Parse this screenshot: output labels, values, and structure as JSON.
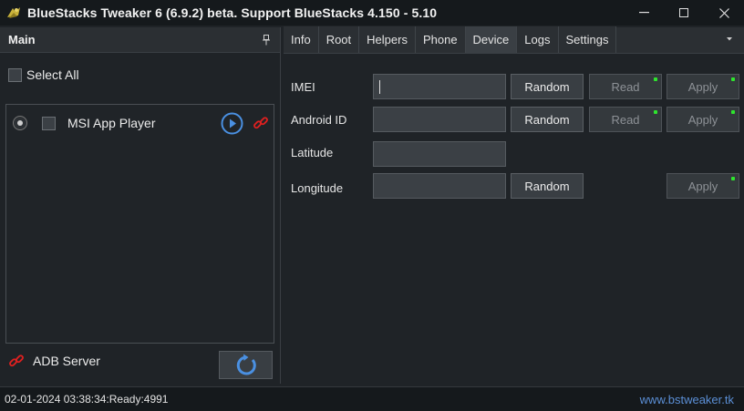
{
  "window": {
    "title": "BlueStacks Tweaker 6 (6.9.2) beta. Support BlueStacks 4.150 - 5.10",
    "minimize_label": "—",
    "maximize_label": "☐",
    "close_label": "✕"
  },
  "left": {
    "header": "Main",
    "select_all": "Select All",
    "players": [
      {
        "name": "MSI App Player",
        "selected": true,
        "checked": false
      }
    ],
    "adb_label": "ADB Server"
  },
  "tabs": [
    {
      "label": "Info",
      "active": false
    },
    {
      "label": "Root",
      "active": false
    },
    {
      "label": "Helpers",
      "active": false
    },
    {
      "label": "Phone",
      "active": false
    },
    {
      "label": "Device",
      "active": true
    },
    {
      "label": "Logs",
      "active": false
    },
    {
      "label": "Settings",
      "active": false
    }
  ],
  "device": {
    "imei": {
      "label": "IMEI",
      "value": "",
      "random": "Random",
      "read": "Read",
      "apply": "Apply"
    },
    "android_id": {
      "label": "Android ID",
      "value": "",
      "random": "Random",
      "read": "Read",
      "apply": "Apply"
    },
    "latitude": {
      "label": "Latitude",
      "value": ""
    },
    "longitude": {
      "label": "Longitude",
      "value": "",
      "random": "Random",
      "apply": "Apply"
    }
  },
  "status": {
    "text": "02-01-2024 03:38:34:Ready:4991",
    "link": "www.bstweaker.tk"
  },
  "colors": {
    "accent_blue": "#4a90e2",
    "link_red": "#e02020",
    "indicator_green": "#2ee52e"
  }
}
